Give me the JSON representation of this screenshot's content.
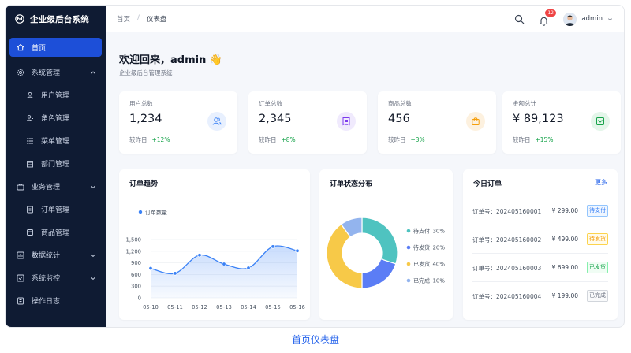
{
  "app": {
    "title": "企业级后台系统"
  },
  "sidebar": {
    "items": [
      {
        "label": "首页",
        "icon": "home-icon",
        "active": true
      },
      {
        "label": "系统管理",
        "icon": "gear-icon",
        "expanded": true
      },
      {
        "label": "用户管理",
        "icon": "user-icon"
      },
      {
        "label": "角色管理",
        "icon": "role-icon"
      },
      {
        "label": "菜单管理",
        "icon": "list-icon"
      },
      {
        "label": "部门管理",
        "icon": "department-icon"
      },
      {
        "label": "业务管理",
        "icon": "briefcase-icon",
        "expanded": true
      },
      {
        "label": "订单管理",
        "icon": "order-icon"
      },
      {
        "label": "商品管理",
        "icon": "product-icon"
      },
      {
        "label": "数据统计",
        "icon": "chart-icon"
      },
      {
        "label": "系统监控",
        "icon": "monitor-icon"
      },
      {
        "label": "操作日志",
        "icon": "log-icon"
      }
    ]
  },
  "header": {
    "breadcrumb": [
      "首页",
      "仪表盘"
    ],
    "separator": "/",
    "notification_count": "12",
    "username": "admin"
  },
  "welcome": {
    "title": "欢迎回来，admin 👋",
    "subtitle": "企业级后台管理系统"
  },
  "stats": [
    {
      "label": "用户总数",
      "value": "1,234",
      "compare_label": "较昨日",
      "change": "+12%",
      "icon": "users-icon",
      "color": "#3b82f6",
      "bg": "#e8f0fe"
    },
    {
      "label": "订单总数",
      "value": "2,345",
      "compare_label": "较昨日",
      "change": "+8%",
      "icon": "receipt-icon",
      "color": "#7c3aed",
      "bg": "#f0eafd"
    },
    {
      "label": "商品总数",
      "value": "456",
      "compare_label": "较昨日",
      "change": "+3%",
      "icon": "shopping-bag-icon",
      "color": "#f59e0b",
      "bg": "#fdf1df"
    },
    {
      "label": "金额总计",
      "value": "¥ 89,123",
      "compare_label": "较昨日",
      "change": "+15%",
      "icon": "wallet-icon",
      "color": "#16a34a",
      "bg": "#e4f6ea"
    }
  ],
  "trend": {
    "title": "订单趋势",
    "chart_data": {
      "type": "area",
      "series": [
        {
          "name": "订单数量",
          "values": [
            760,
            630,
            1100,
            870,
            770,
            1320,
            1210
          ]
        }
      ],
      "categories": [
        "05-10",
        "05-11",
        "05-12",
        "05-13",
        "05-14",
        "05-15",
        "05-16"
      ],
      "yticks": [
        "1,500",
        "1,200",
        "900",
        "600",
        "300",
        "0"
      ],
      "ylim": [
        0,
        1500
      ],
      "color": "#3b82f6"
    }
  },
  "status": {
    "title": "订单状态分布",
    "chart_data": {
      "type": "pie",
      "categories": [
        "待支付",
        "待发货",
        "已发货",
        "已完成"
      ],
      "values": [
        30,
        20,
        40,
        10
      ],
      "labels": [
        "30%",
        "20%",
        "40%",
        "10%"
      ],
      "colors": [
        "#4fc3c0",
        "#5b7df5",
        "#f7c948",
        "#93b4ee"
      ]
    }
  },
  "today": {
    "title": "今日订单",
    "more": "更多",
    "orders": [
      {
        "no": "订单号：202405160001",
        "amount": "¥ 299.00",
        "status": "待支付",
        "color": "#3b82f6"
      },
      {
        "no": "订单号：202405160002",
        "amount": "¥ 499.00",
        "status": "待发货",
        "color": "#f59e0b"
      },
      {
        "no": "订单号：202405160003",
        "amount": "¥ 699.00",
        "status": "已发货",
        "color": "#16a34a"
      },
      {
        "no": "订单号：202405160004",
        "amount": "¥ 199.00",
        "status": "已完成",
        "color": "#6b7280"
      }
    ]
  },
  "caption": "首页仪表盘"
}
